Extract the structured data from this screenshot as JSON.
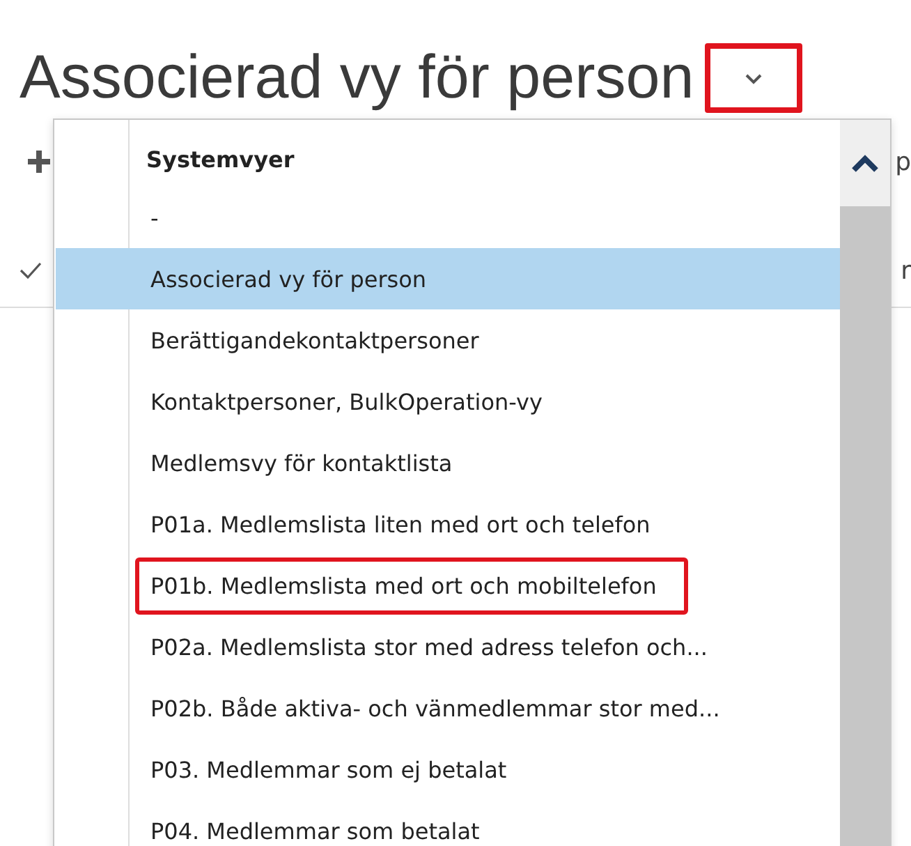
{
  "title": "Associerad vy för person",
  "view_selector_button": {
    "highlighted": true
  },
  "background": {
    "toolbar_fragment": "p",
    "row_fragment": "r",
    "row_checked": true
  },
  "dropdown": {
    "heading": "Systemvyer",
    "items": [
      {
        "label": "-",
        "selected": false,
        "highlighted": false
      },
      {
        "label": "Associerad vy för person",
        "selected": true,
        "highlighted": false
      },
      {
        "label": "Berättigandekontaktpersoner",
        "selected": false,
        "highlighted": false
      },
      {
        "label": "Kontaktpersoner, BulkOperation-vy",
        "selected": false,
        "highlighted": false
      },
      {
        "label": "Medlemsvy för kontaktlista",
        "selected": false,
        "highlighted": false
      },
      {
        "label": "P01a. Medlemslista liten med ort och telefon",
        "selected": false,
        "highlighted": false
      },
      {
        "label": "P01b. Medlemslista med ort och mobiltelefon",
        "selected": false,
        "highlighted": true
      },
      {
        "label": "P02a. Medlemslista stor med adress telefon och...",
        "selected": false,
        "highlighted": false
      },
      {
        "label": "P02b. Både aktiva- och vänmedlemmar stor med...",
        "selected": false,
        "highlighted": false
      },
      {
        "label": "P03. Medlemmar som ej betalat",
        "selected": false,
        "highlighted": false
      },
      {
        "label": "P04. Medlemmar som betalat",
        "selected": false,
        "highlighted": false
      }
    ]
  }
}
